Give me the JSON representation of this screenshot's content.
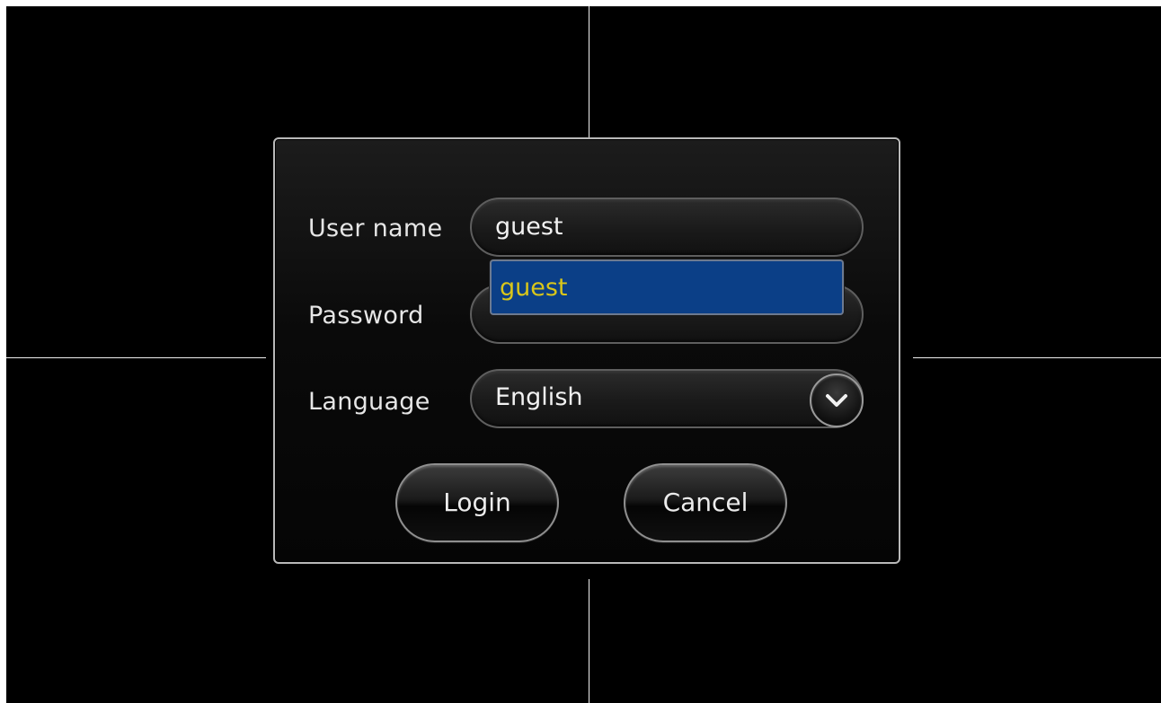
{
  "login": {
    "username_label": "User name",
    "username_value": "guest",
    "username_options": [
      "guest"
    ],
    "password_label": "Password",
    "password_value": "",
    "language_label": "Language",
    "language_value": "English",
    "login_button": "Login",
    "cancel_button": "Cancel"
  },
  "icons": {
    "language_dropdown": "chevron-down-icon"
  },
  "colors": {
    "background": "#000000",
    "dropdown_highlight": "#0b3f87",
    "dropdown_text": "#d9c61a"
  }
}
